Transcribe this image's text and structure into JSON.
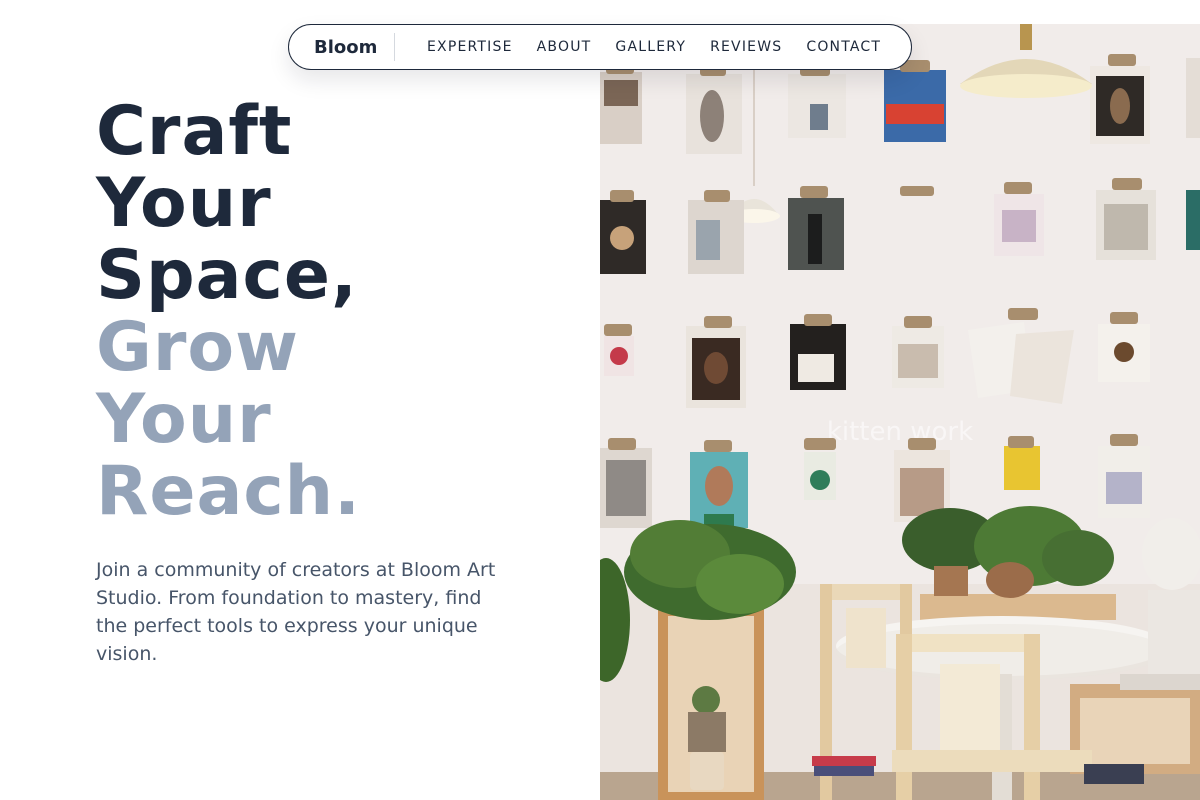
{
  "nav": {
    "brand": "Bloom",
    "links": [
      "EXPERTISE",
      "ABOUT",
      "GALLERY",
      "REVIEWS",
      "CONTACT"
    ]
  },
  "hero": {
    "title_dark": [
      "Craft",
      "Your",
      "Space,"
    ],
    "title_muted": [
      "Grow",
      "Your",
      "Reach."
    ],
    "description": "Join a community of creators at Bloom Art Studio. From foundation to mastery, find the perfect tools to express your unique vision."
  },
  "photo": {
    "watermark": "kitten work"
  },
  "colors": {
    "heading": "#1e293b",
    "heading_muted": "#94a3b8",
    "body_text": "#475569"
  }
}
